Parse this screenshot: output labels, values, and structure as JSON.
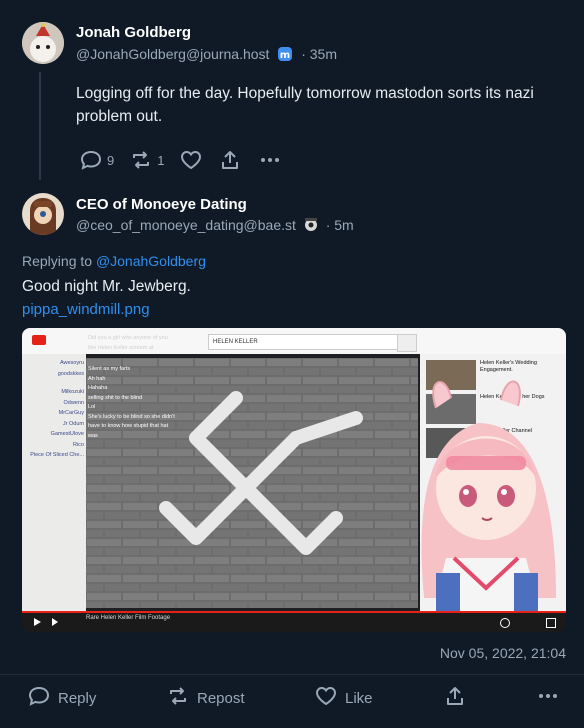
{
  "post1": {
    "display_name": "Jonah Goldberg",
    "handle": "@JonahGoldberg@journa.host",
    "time_ago": "· 35m",
    "text": "Logging off for the day. Hopefully tomorrow mastodon sorts its nazi problem out.",
    "reply_count": "9",
    "repost_count": "1"
  },
  "post2": {
    "display_name": "CEO of Monoeye Dating",
    "handle": "@ceo_of_monoeye_dating@bae.st",
    "time_ago": "· 5m",
    "replying_prefix": "Replying to ",
    "replying_to": "@JonahGoldberg",
    "text": "Good night Mr. Jewberg.",
    "attachment_name": "pippa_windmill.png",
    "timestamp": "Nov 05, 2022, 21:04"
  },
  "media": {
    "search_text": "HELEN KELLER",
    "video_title": "Rare Helen Keller Film Footage",
    "chat_users": [
      "Awesoyru",
      "goodskkes",
      "Milkozuki",
      "Odwenn",
      "MrCarGuy",
      "Jr Odum",
      "GamestUlove",
      "Rico",
      "Piece Of Sliced Che..."
    ],
    "chat_lines": [
      "Did you a girl who anyone of you",
      "like Helen Keller scream at",
      "Silent as my farts",
      "Ah hah",
      "Hahaha",
      "selling shit to the blind",
      "Lol",
      "She's lucky to be blind so she didn't",
      "have to know how stupid that hat",
      "was"
    ],
    "sidebar": [
      "Helen Keller's Wedding Engagement.",
      "Helen Keller and her Dogs",
      "Helen Keller Channel"
    ]
  },
  "bottom_bar": {
    "reply": "Reply",
    "repost": "Repost",
    "like": "Like"
  },
  "colors": {
    "bg": "#0f1a26",
    "link": "#2f8ff0",
    "muted": "#9aa8b7"
  }
}
